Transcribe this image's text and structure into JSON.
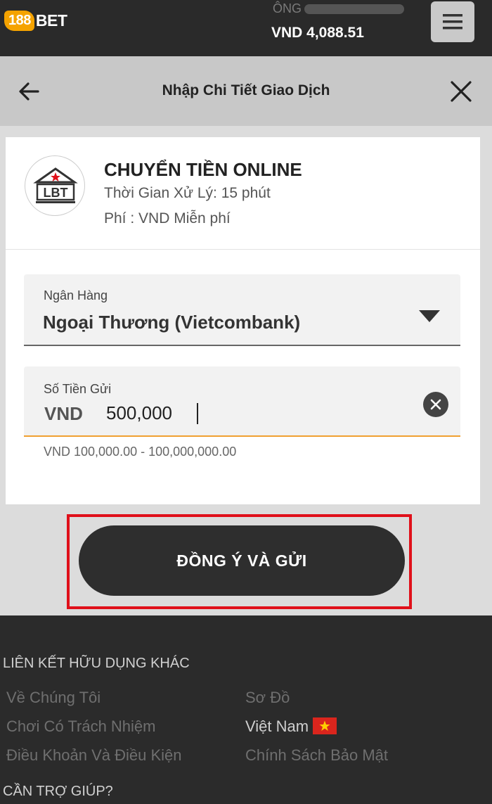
{
  "header": {
    "logo_num": "188",
    "logo_text": "BET",
    "user_prefix": "ÔNG",
    "balance": "VND 4,088.51",
    "menu_icon": "hamburger-icon"
  },
  "titlebar": {
    "title": "Nhập Chi Tiết Giao Dịch",
    "back_icon": "arrow-left-icon",
    "close_icon": "close-icon"
  },
  "method": {
    "logo_text": "LBT",
    "name": "CHUYỂN TIỀN ONLINE",
    "time": "Thời Gian Xử Lý: 15 phút",
    "fee": "Phí : VND Miễn phí"
  },
  "form": {
    "bank_label": "Ngân Hàng",
    "bank_value": "Ngoại Thương (Vietcombank)",
    "amount_label": "Số Tiền Gửi",
    "currency": "VND",
    "amount_value": "500,000",
    "range_hint": "VND 100,000.00 - 100,000,000.00"
  },
  "submit_label": "ĐỒNG Ý VÀ GỬI",
  "footer": {
    "links_heading": "LIÊN KẾT HỮU DỤNG KHÁC",
    "links": {
      "about": "Về Chúng Tôi",
      "sitemap": "Sơ Đồ",
      "responsible": "Chơi Có Trách Nhiệm",
      "language": "Việt Nam",
      "terms": "Điều Khoản Và Điều Kiện",
      "privacy": "Chính Sách Bảo Mật"
    },
    "help_heading": "CẦN TRỢ GIÚP?"
  },
  "colors": {
    "brand_orange": "#f5a300",
    "header_bg": "#2a2a2a",
    "highlight_red": "#e0101a",
    "input_focus": "#f0a030"
  }
}
